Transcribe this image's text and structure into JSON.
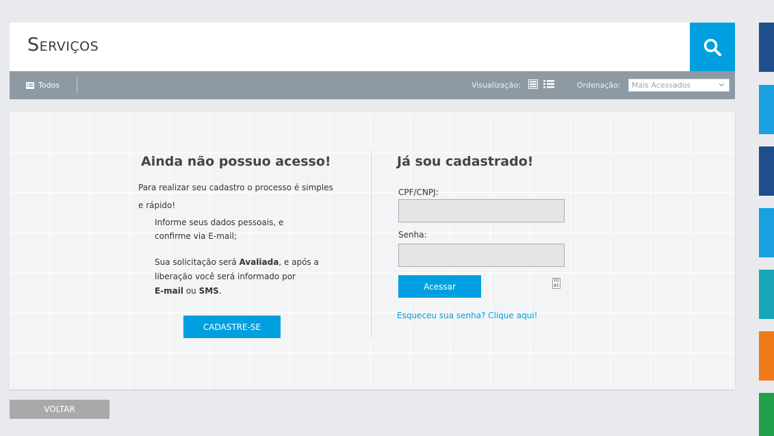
{
  "header": {
    "title": "Serviços",
    "search_icon": "search-icon"
  },
  "toolbar": {
    "filter_label": "Todos",
    "view_label": "Visualização:",
    "order_label": "Ordenação:",
    "order_value": "Mais Acessados"
  },
  "register": {
    "heading": "Ainda não possuo acesso!",
    "intro_line1": "Para realizar seu cadastro o processo é simples",
    "intro_line2": "e rápido!",
    "step1_line1": "Informe seus dados pessoais, e",
    "step1_line2": "confirme via E-mail;",
    "step2_prefix": "Sua solicitação será ",
    "step2_bold": "Avaliada",
    "step2_suffix": ", e após a",
    "step2_line2": "liberação você será informado por",
    "step2_email": "E-mail",
    "step2_or": " ou ",
    "step2_sms": "SMS",
    "step2_end": ".",
    "button": "CADASTRE-SE"
  },
  "login": {
    "heading": "Já sou cadastrado!",
    "cpf_label": "CPF/CNPJ:",
    "password_label": "Senha:",
    "button": "Acessar",
    "forgot_link": "Esqueceu sua senha? Clique aqui!",
    "captcha_text": "F0 85"
  },
  "footer": {
    "back_button": "VOLTAR"
  },
  "colors": {
    "accent": "#00a0e0",
    "toolbar": "#8d9aa3",
    "tiles": [
      "#1e4f8c",
      "#1aa0e0",
      "#1e4f8c",
      "#1aa0e0",
      "#18a6b8",
      "#f07a1a",
      "#22a04a"
    ]
  }
}
